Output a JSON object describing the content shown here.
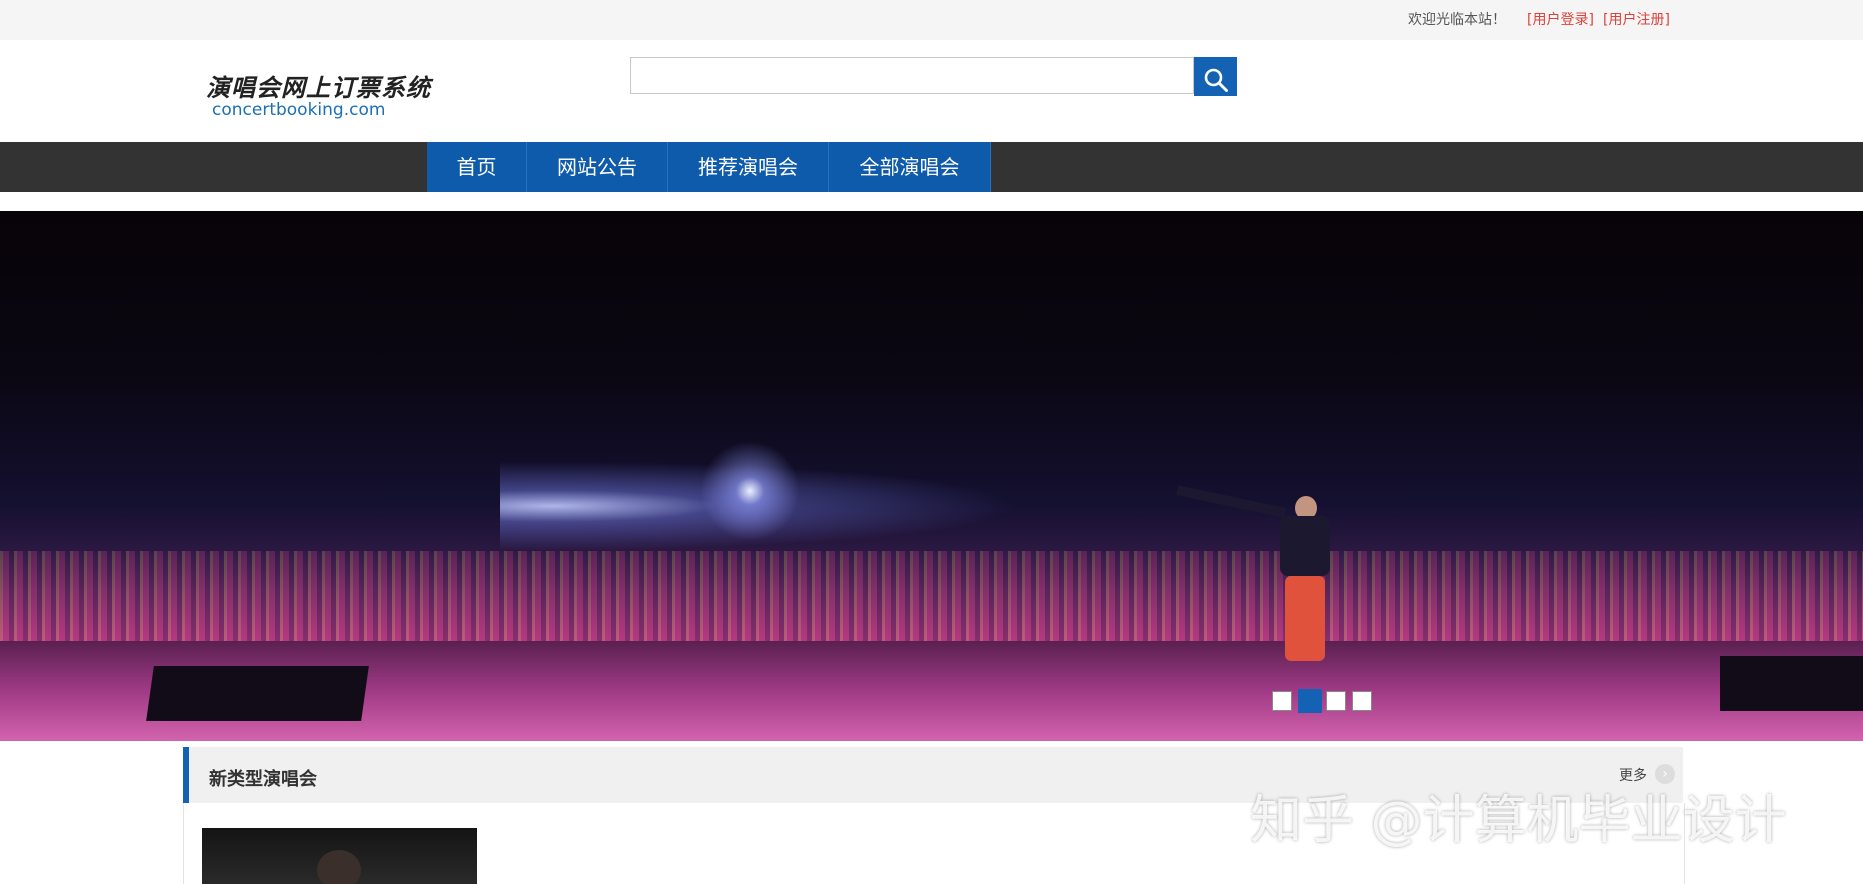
{
  "topbar": {
    "welcome": "欢迎光临本站！",
    "login": "[用户登录]",
    "register": "[用户注册]"
  },
  "logo": {
    "cn": "演唱会网上订票系统",
    "en": "concertbooking.com"
  },
  "search": {
    "value": "",
    "placeholder": ""
  },
  "nav": [
    {
      "label": "首页"
    },
    {
      "label": "网站公告"
    },
    {
      "label": "推荐演唱会"
    },
    {
      "label": "全部演唱会"
    }
  ],
  "carousel": {
    "slide_count": 4,
    "active_index": 1
  },
  "section": {
    "title": "新类型演唱会",
    "more": "更多"
  },
  "watermark": "知乎 @计算机毕业设计",
  "colors": {
    "accent": "#1462b4",
    "nav_bg": "#333333",
    "link_red": "#e0413a"
  },
  "icons": {
    "search": "search-icon",
    "more": "chevron-right-icon"
  }
}
